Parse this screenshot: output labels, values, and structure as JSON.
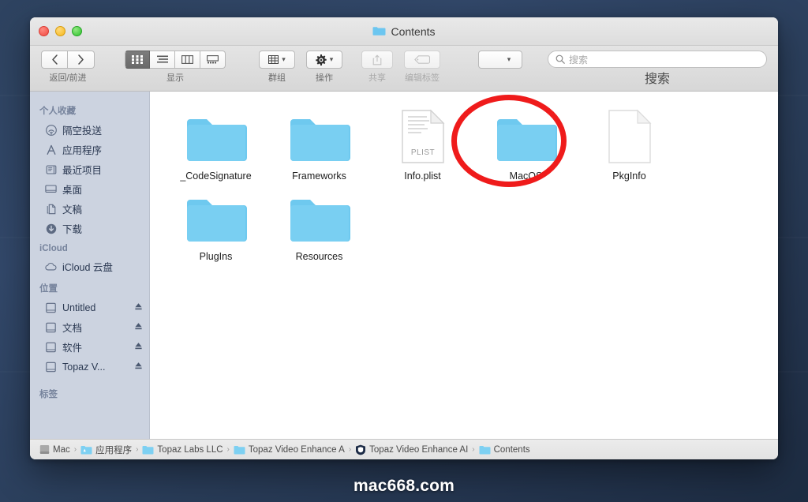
{
  "desktop": {
    "watermark": "mac668.com",
    "background_color": "#2b3f5c"
  },
  "window": {
    "title": "Contents",
    "traffic_lights": [
      {
        "name": "close",
        "color": "#f04a42"
      },
      {
        "name": "minimize",
        "color": "#f5b81c"
      },
      {
        "name": "zoom",
        "color": "#2cc22c"
      }
    ]
  },
  "toolbar": {
    "nav": {
      "label": "返回/前进",
      "back_icon": "chevron-left-icon",
      "forward_icon": "chevron-right-icon"
    },
    "view": {
      "label": "显示",
      "options": [
        {
          "name": "icon-view",
          "icon": "grid-icon",
          "selected": true
        },
        {
          "name": "list-view",
          "icon": "list-icon",
          "selected": false
        },
        {
          "name": "column-view",
          "icon": "columns-icon",
          "selected": false
        },
        {
          "name": "gallery-view",
          "icon": "gallery-icon",
          "selected": false
        }
      ]
    },
    "group": {
      "label": "群组",
      "icon": "grid-small-icon"
    },
    "action": {
      "label": "操作",
      "icon": "gear-icon"
    },
    "share": {
      "label": "共享",
      "icon": "share-icon",
      "disabled": true
    },
    "tags": {
      "label": "编辑标签",
      "icon": "tag-icon",
      "disabled": true
    },
    "extra": {
      "label": "",
      "icon": "chevron-down-icon"
    },
    "search": {
      "label": "搜索",
      "placeholder": "搜索",
      "value": "",
      "icon": "search-icon"
    }
  },
  "sidebar": {
    "sections": [
      {
        "header": "个人收藏",
        "items": [
          {
            "label": "隔空投送",
            "icon": "airdrop-icon",
            "eject": false
          },
          {
            "label": "应用程序",
            "icon": "applications-icon",
            "eject": false
          },
          {
            "label": "最近项目",
            "icon": "recents-icon",
            "eject": false
          },
          {
            "label": "桌面",
            "icon": "desktop-icon",
            "eject": false
          },
          {
            "label": "文稿",
            "icon": "documents-icon",
            "eject": false
          },
          {
            "label": "下载",
            "icon": "downloads-icon",
            "eject": false
          }
        ]
      },
      {
        "header": "iCloud",
        "items": [
          {
            "label": "iCloud 云盘",
            "icon": "cloud-icon",
            "eject": false
          }
        ]
      },
      {
        "header": "位置",
        "items": [
          {
            "label": "Untitled",
            "icon": "disk-icon",
            "eject": true
          },
          {
            "label": "文档",
            "icon": "disk-icon",
            "eject": true
          },
          {
            "label": "软件",
            "icon": "disk-icon",
            "eject": true
          },
          {
            "label": "Topaz V...",
            "icon": "disk-icon",
            "eject": true
          }
        ]
      },
      {
        "header": "标签",
        "items": []
      }
    ]
  },
  "files": [
    {
      "name": "_CodeSignature",
      "type": "folder",
      "highlighted": false
    },
    {
      "name": "Frameworks",
      "type": "folder",
      "highlighted": false
    },
    {
      "name": "Info.plist",
      "type": "plist-file",
      "badge": "PLIST",
      "highlighted": false
    },
    {
      "name": "MacOS",
      "type": "folder",
      "highlighted": true
    },
    {
      "name": "PkgInfo",
      "type": "blank-file",
      "highlighted": false
    },
    {
      "name": "PlugIns",
      "type": "folder",
      "highlighted": false
    },
    {
      "name": "Resources",
      "type": "folder",
      "highlighted": false
    }
  ],
  "annotation": {
    "shape": "circle",
    "color": "#ef1b1b",
    "target": "MacOS"
  },
  "pathbar": {
    "crumbs": [
      {
        "label": "Mac",
        "icon": "drive-icon"
      },
      {
        "label": "应用程序",
        "icon": "apps-folder-icon"
      },
      {
        "label": "Topaz Labs LLC",
        "icon": "folder-icon"
      },
      {
        "label": "Topaz Video Enhance A",
        "icon": "folder-icon"
      },
      {
        "label": "Topaz Video Enhance AI",
        "icon": "app-icon"
      },
      {
        "label": "Contents",
        "icon": "folder-icon"
      }
    ],
    "separator": "›"
  }
}
